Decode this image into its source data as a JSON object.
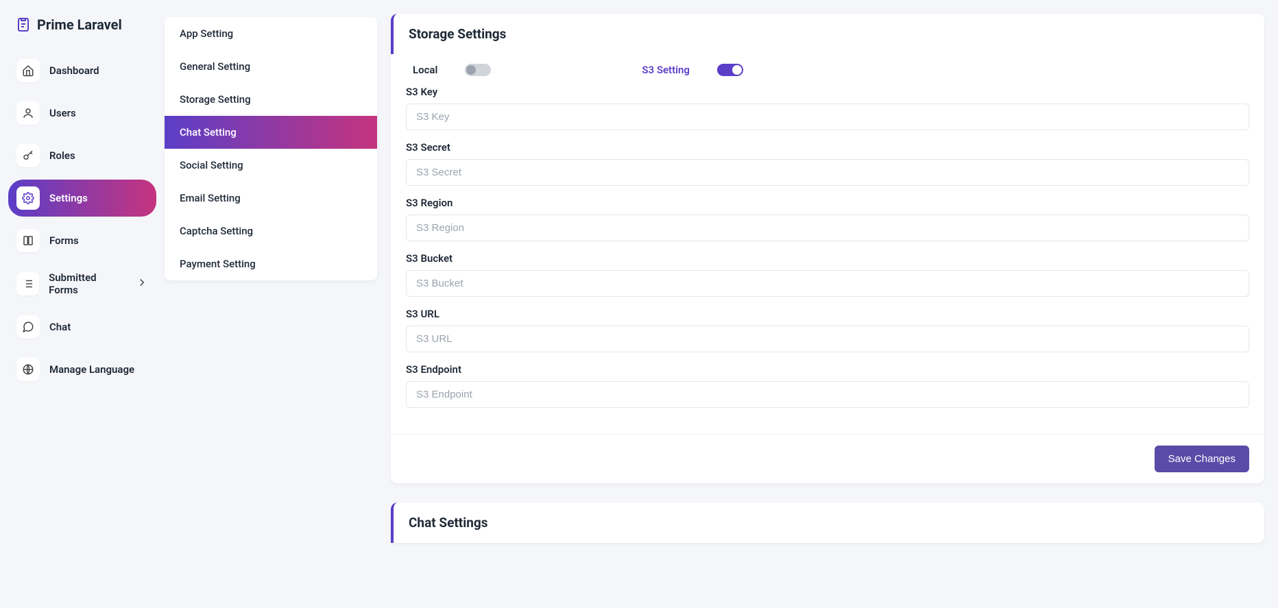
{
  "logo": {
    "text": "Prime Laravel"
  },
  "nav": {
    "dashboard": "Dashboard",
    "users": "Users",
    "roles": "Roles",
    "settings": "Settings",
    "forms": "Forms",
    "submitted_forms": "Submitted Forms",
    "chat": "Chat",
    "manage_language": "Manage Language"
  },
  "sub": {
    "app": "App Setting",
    "general": "General Setting",
    "storage": "Storage Setting",
    "chat": "Chat Setting",
    "social": "Social Setting",
    "email": "Email Setting",
    "captcha": "Captcha Setting",
    "payment": "Payment Setting"
  },
  "storage_card": {
    "title": "Storage Settings",
    "local_label": "Local",
    "s3_label": "S3 Setting",
    "s3_key_label": "S3 Key",
    "s3_key_ph": "S3 Key",
    "s3_secret_label": "S3 Secret",
    "s3_secret_ph": "S3 Secret",
    "s3_region_label": "S3 Region",
    "s3_region_ph": "S3 Region",
    "s3_bucket_label": "S3 Bucket",
    "s3_bucket_ph": "S3 Bucket",
    "s3_url_label": "S3 URL",
    "s3_url_ph": "S3 URL",
    "s3_endpoint_label": "S3 Endpoint",
    "s3_endpoint_ph": "S3 Endpoint",
    "save_btn": "Save Changes"
  },
  "chat_card": {
    "title": "Chat Settings"
  }
}
